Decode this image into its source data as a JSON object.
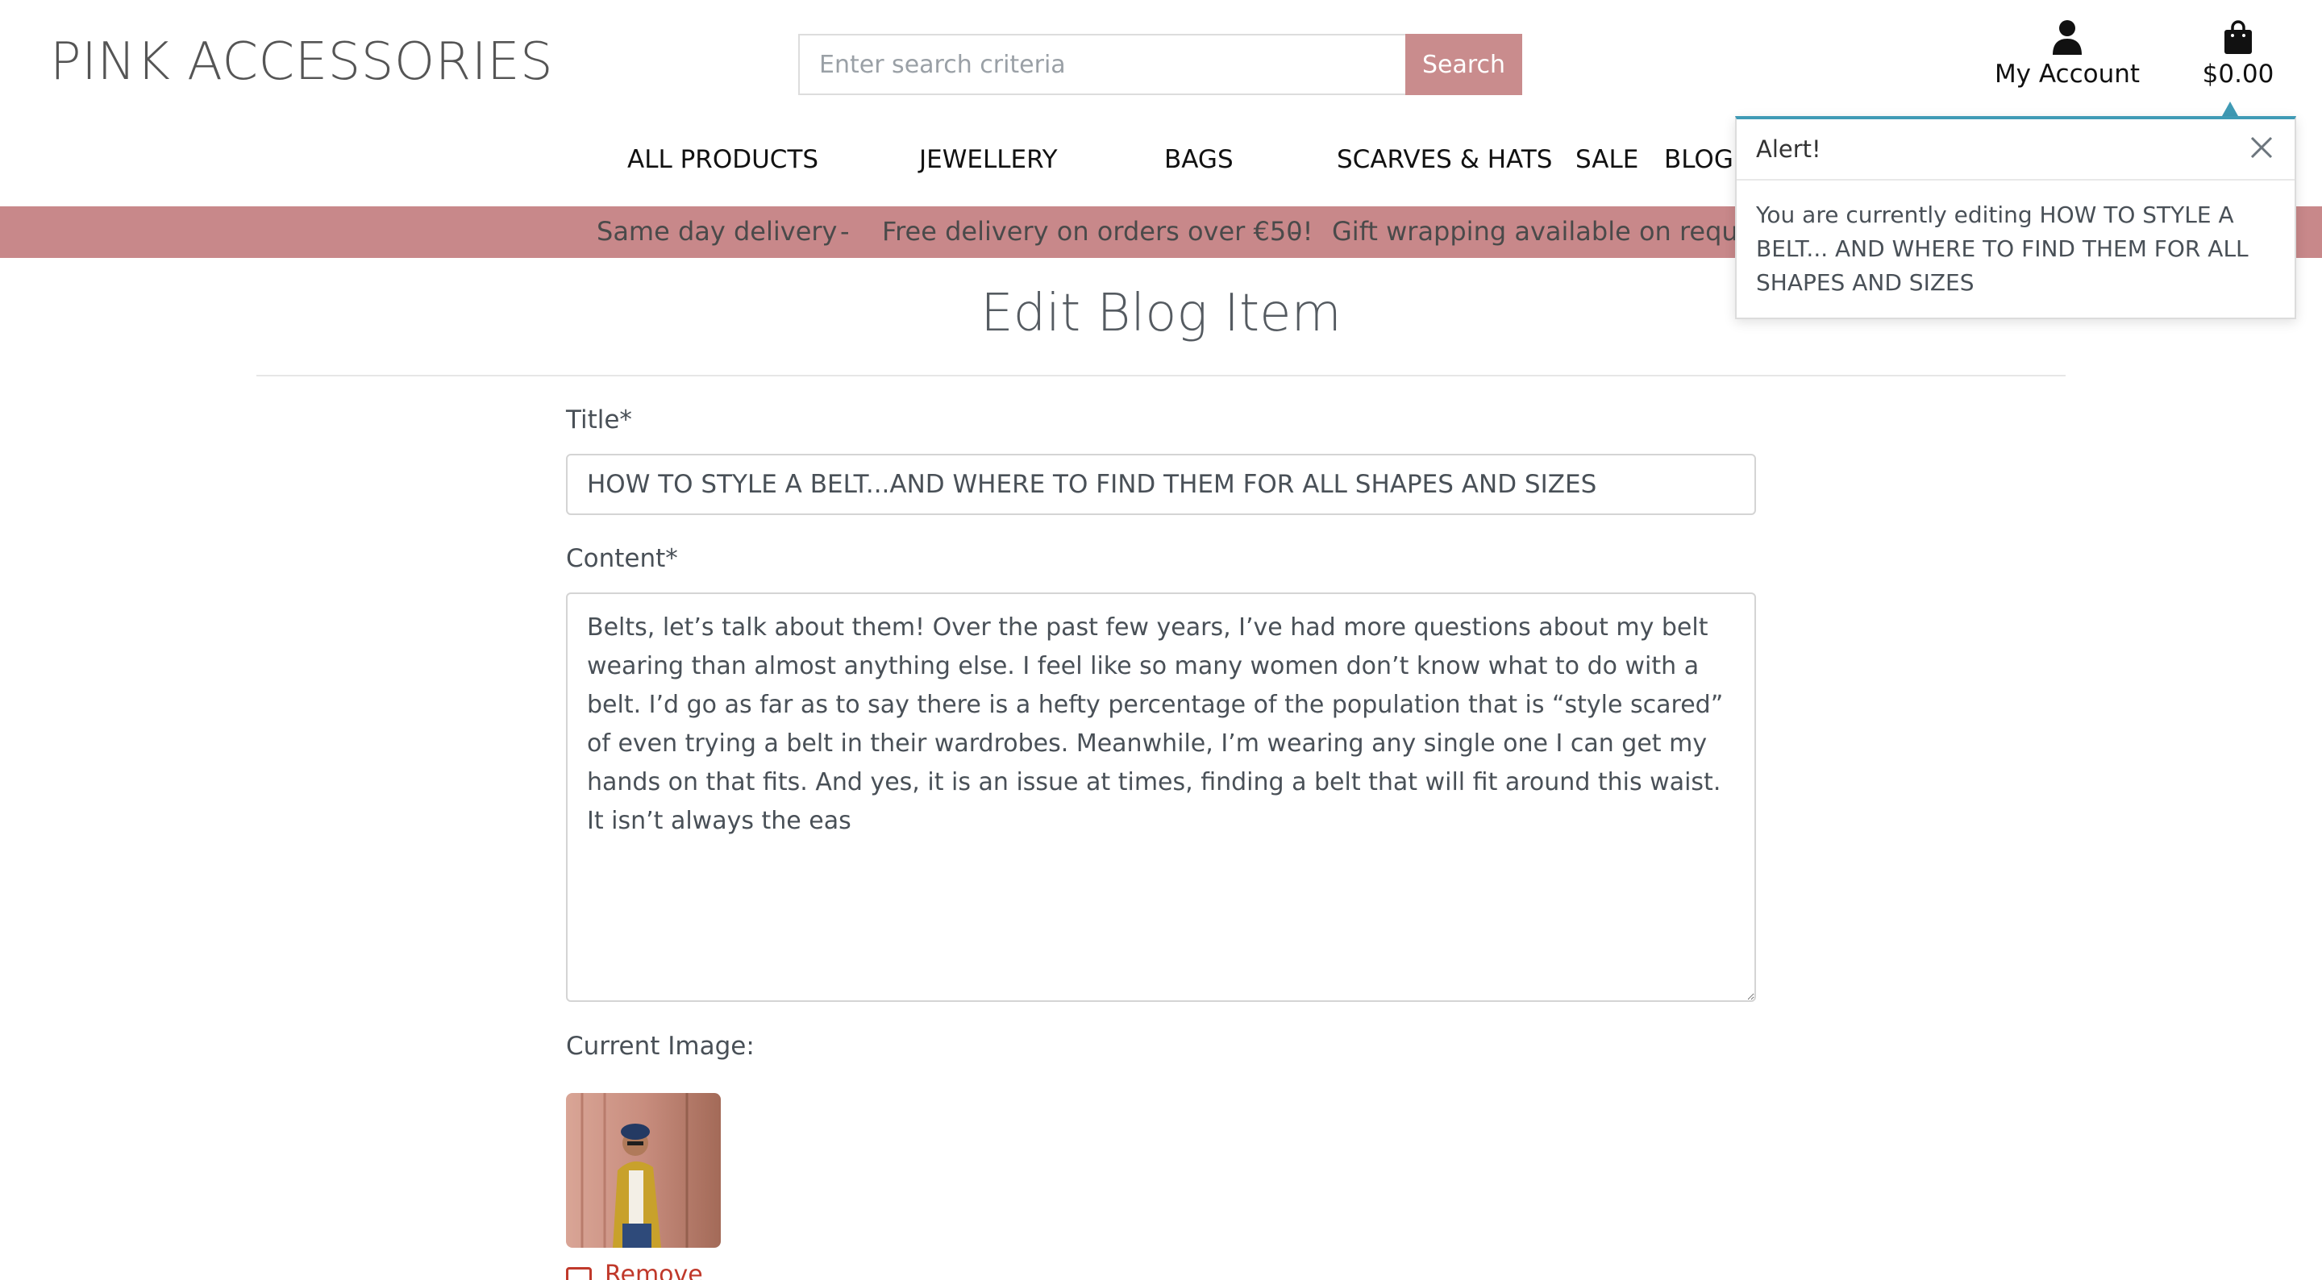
{
  "header": {
    "logo": "PINK ACCESSORIES",
    "search": {
      "placeholder": "Enter search criteria",
      "button_label": "Search"
    },
    "account_label": "My Account",
    "bag_total": "$0.00"
  },
  "nav": {
    "items": [
      "ALL PRODUCTS",
      "JEWELLERY",
      "BAGS",
      "SCARVES & HATS",
      "SALE",
      "BLOG"
    ]
  },
  "banner": {
    "items": [
      "Same day delivery",
      "-",
      "Free delivery on orders over €50!",
      "-",
      "Gift wrapping available on request"
    ]
  },
  "page": {
    "title": "Edit Blog Item"
  },
  "form": {
    "title_label": "Title*",
    "title_value": "HOW TO STYLE A BELT...AND WHERE TO FIND THEM FOR ALL SHAPES AND SIZES",
    "content_label": "Content*",
    "content_value": "Belts, let’s talk about them! Over the past few years, I’ve had more questions about my belt wearing than almost anything else. I feel like so many women don’t know what to do with a belt. I’d go as far as to say there is a hefty percentage of the population that is “style scared” of even trying a belt in their wardrobes. Meanwhile, I’m wearing any single one I can get my hands on that fits. And yes, it is an issue at times, finding a belt that will fit around this waist. It isn’t always the eas",
    "current_image_label": "Current Image:",
    "remove_label": "Remove"
  },
  "toast": {
    "title": "Alert!",
    "message": "You are currently editing HOW TO STYLE A BELT... AND WHERE TO FIND THEM FOR ALL SHAPES AND SIZES"
  },
  "colors": {
    "accent_pink": "#c98c8d",
    "banner_pink": "#c8888a",
    "toast_accent": "#3f9ab5",
    "remove_red": "#c0392b"
  },
  "icons": {
    "account": "user-icon",
    "bag": "shopping-bag-icon",
    "close": "close-icon"
  }
}
